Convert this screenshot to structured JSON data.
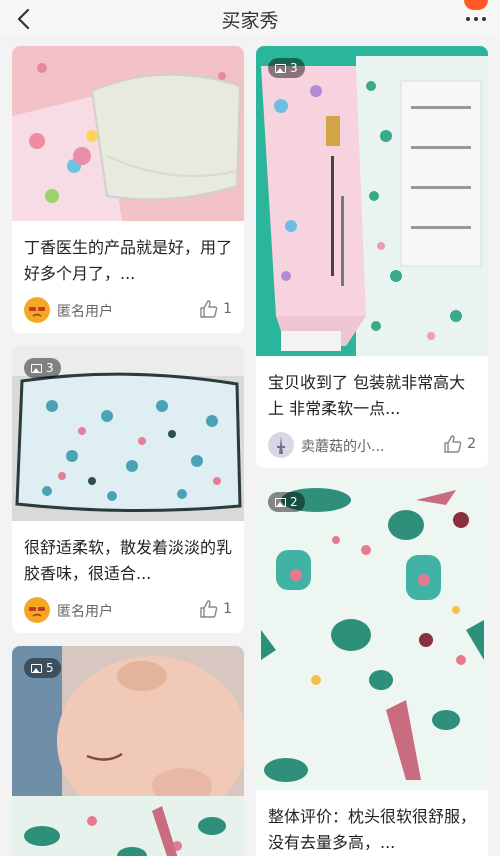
{
  "header": {
    "title": "买家秀"
  },
  "cards": [
    {
      "text": "丁香医生的产品就是好，用了好多个月了，...",
      "user": "匿名用户",
      "likes": "1"
    },
    {
      "count": "3",
      "text": "宝贝收到了 包装就非常高大上 非常柔软一点...",
      "user": "卖蘑菇的小...",
      "likes": "2"
    },
    {
      "count": "3",
      "text": "很舒适柔软，散发着淡淡的乳胶香味，很适合...",
      "user": "匿名用户",
      "likes": "1"
    },
    {
      "count": "2",
      "text": "整体评价：枕头很软很舒服，没有去量多高，...",
      "user": "",
      "likes": ""
    },
    {
      "count": "5",
      "text": "",
      "user": "",
      "likes": ""
    }
  ],
  "colors": {
    "accent": "#ff5a26",
    "avatar": "#f5a623"
  }
}
